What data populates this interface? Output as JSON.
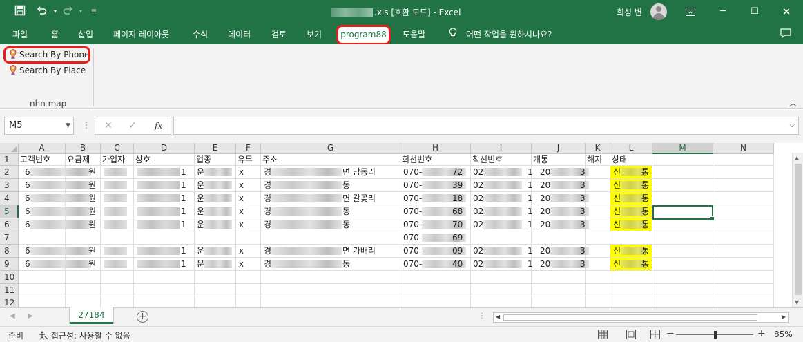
{
  "window": {
    "title": ".xls  [호환 모드]  -  Excel",
    "user": "희성 변"
  },
  "menu": {
    "tabs": [
      "파일",
      "홈",
      "삽입",
      "페이지 레이아웃",
      "수식",
      "데이터",
      "검토",
      "보기",
      "program88",
      "도움말"
    ],
    "active_tab": "program88",
    "tell_me": "어떤 작업을 원하시나요?"
  },
  "ribbon": {
    "search_by_phone": "Search By Phone",
    "search_by_place": "Search By Place",
    "group_label": "nhn map"
  },
  "formula_bar": {
    "name_box": "M5",
    "fx": "fx",
    "value": ""
  },
  "grid": {
    "columns": [
      "A",
      "B",
      "C",
      "D",
      "E",
      "F",
      "G",
      "H",
      "I",
      "J",
      "K",
      "L",
      "M",
      "N"
    ],
    "selected_column": "M",
    "selected_row": "5",
    "rows": [
      "1",
      "2",
      "3",
      "4",
      "5",
      "6",
      "7",
      "8",
      "9",
      "10",
      "11",
      "12"
    ],
    "headers": [
      "고객번호",
      "요금제",
      "가입자",
      "상호",
      "업종",
      "유무",
      "주소",
      "회선번호",
      "착신번호",
      "개통",
      "해지",
      "상태"
    ],
    "data": [
      {
        "a": "6",
        "b": "원",
        "d": "1",
        "e": "운",
        "f": "x",
        "g1": "경",
        "g2": "면 남동리",
        "h1": "070-",
        "h2": "72",
        "i1": "02",
        "i2": "1",
        "j1": "20",
        "j2": "3",
        "l1": "신",
        "l2": "통"
      },
      {
        "a": "6",
        "b": "원",
        "d": "1",
        "e": "운",
        "f": "x",
        "g1": "경",
        "g2": "동",
        "h1": "070-",
        "h2": "39",
        "i1": "02",
        "i2": "1",
        "j1": "20",
        "j2": "3",
        "l1": "신",
        "l2": "통"
      },
      {
        "a": "6",
        "b": "원",
        "d": "1",
        "e": "운",
        "f": "x",
        "g1": "경",
        "g2": "면 갈곶리",
        "h1": "070-",
        "h2": "18",
        "i1": "02",
        "i2": "1",
        "j1": "20",
        "j2": "3",
        "l1": "신",
        "l2": "통"
      },
      {
        "a": "6",
        "b": "원",
        "d": "1",
        "e": "운",
        "f": "x",
        "g1": "경",
        "g2": "동",
        "h1": "070-",
        "h2": "68",
        "i1": "02",
        "i2": "1",
        "j1": "20",
        "j2": "3",
        "l1": "신",
        "l2": "통"
      },
      {
        "a": "6",
        "b": "원",
        "d": "1",
        "e": "운",
        "f": "x",
        "g1": "경",
        "g2": "동",
        "h1": "070-",
        "h2": "70",
        "i1": "02",
        "i2": "1",
        "j1": "20",
        "j2": "3",
        "l1": "신",
        "l2": "통"
      },
      {
        "a": "",
        "b": "",
        "d": "",
        "e": "",
        "f": "",
        "g1": "",
        "g2": "",
        "h1": "070-",
        "h2": "69",
        "i1": "",
        "i2": "",
        "j1": "",
        "j2": "",
        "l1": "",
        "l2": ""
      },
      {
        "a": "6",
        "b": "원",
        "d": "1",
        "e": "운",
        "f": "x",
        "g1": "경",
        "g2": "면 가배리",
        "h1": "070-",
        "h2": "09",
        "i1": "02",
        "i2": "1",
        "j1": "20",
        "j2": "3",
        "l1": "신",
        "l2": "통"
      },
      {
        "a": "6",
        "b": "원",
        "d": "1",
        "e": "운",
        "f": "x",
        "g1": "경",
        "g2": "동",
        "h1": "070-",
        "h2": "40",
        "i1": "02",
        "i2": "1",
        "j1": "20",
        "j2": "3",
        "l1": "신",
        "l2": "통"
      }
    ]
  },
  "sheets": {
    "active": "27184"
  },
  "status": {
    "ready": "준비",
    "accessibility": "접근성: 사용할 수 없음",
    "zoom": "85%"
  }
}
